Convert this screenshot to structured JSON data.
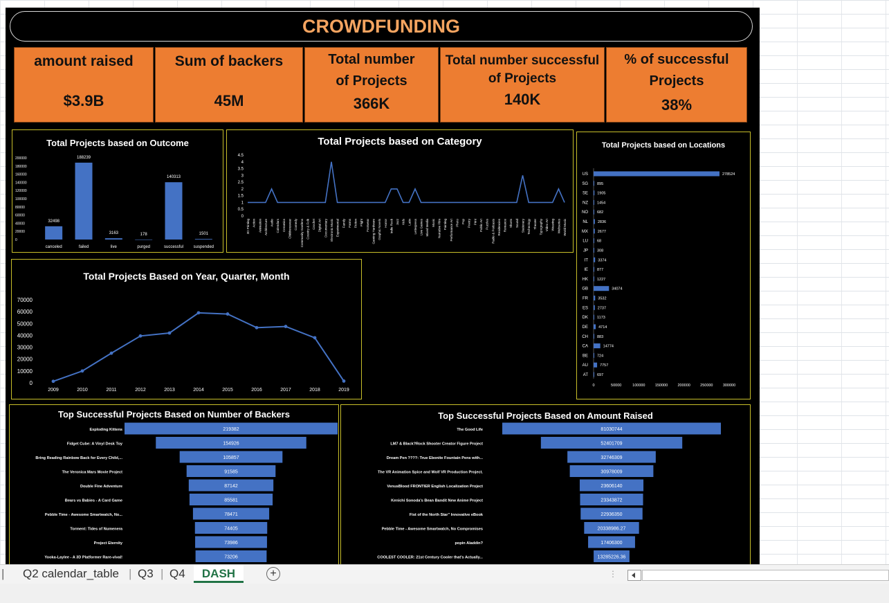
{
  "title": "CROWDFUNDING",
  "kpis": [
    {
      "label": "amount raised",
      "value": "$3.9B"
    },
    {
      "label": "Sum of backers",
      "value": "45M"
    },
    {
      "label": "Total number of Projects",
      "value": "366K"
    },
    {
      "label": "Total number successful of Projects",
      "value": "140K"
    },
    {
      "label": "% of successful Projects",
      "value": "38%"
    }
  ],
  "colors": {
    "bar": "#4472c4",
    "kpi": "#ed7d31",
    "title": "#f4a460",
    "panel_border": "#c9c02a",
    "tab_active": "#217346"
  },
  "sheet_tabs": [
    {
      "label": "Q2 calendar_table",
      "active": false
    },
    {
      "label": "Q3",
      "active": false
    },
    {
      "label": "Q4",
      "active": false
    },
    {
      "label": "DASH",
      "active": true
    }
  ],
  "add_sheet_icon": "plus-circle-icon",
  "chart_data": [
    {
      "type": "bar",
      "title": "Total Projects based on Outcome",
      "categories": [
        "canceled",
        "failed",
        "live",
        "purged",
        "successful",
        "suspended"
      ],
      "values": [
        32498,
        188239,
        3163,
        178,
        140313,
        1501
      ],
      "ylim": [
        0,
        200000
      ],
      "yticks": [
        "0",
        "20000",
        "40000",
        "60000",
        "80000",
        "100000",
        "120000",
        "140000",
        "160000",
        "180000",
        "200000"
      ]
    },
    {
      "type": "line",
      "title": "Total Projects based on  Category",
      "yticks": [
        "0",
        "0.5",
        "1",
        "1.5",
        "2",
        "2.5",
        "3",
        "3.5",
        "4",
        "4.5"
      ],
      "ylim": [
        0,
        4.5
      ],
      "categories": [
        "3D Printing",
        "Action",
        "Animation",
        "Architecture",
        "Audio",
        "Calendars",
        "Ceramics",
        "Childrenswear",
        "Comedy",
        "Community Gardens",
        "Country & Folk",
        "Crochet",
        "Digital Art",
        "Documentary",
        "Electronic Music",
        "Experimental",
        "Family",
        "Farms",
        "Fiction",
        "Flight",
        "Footwear",
        "Gaming Hardware",
        "Graphic Novels",
        "Horror",
        "Indie Rock",
        "Jazz",
        "Kids",
        "Latin",
        "Letterpress",
        "Live Games",
        "Mixed Media",
        "Music",
        "Narrative Film",
        "Painting",
        "Performance Art",
        "Photo",
        "Pop",
        "Poetry",
        "Print",
        "Public Art",
        "Puzzles",
        "Radio & Podcasts",
        "Residencies",
        "Romance",
        "Shorts",
        "Sound",
        "Stationery",
        "Technology",
        "Theater",
        "Typography",
        "Video Art",
        "Weaving",
        "Webseries",
        "World Music"
      ],
      "values": [
        1,
        1,
        1,
        1,
        2,
        1,
        1,
        1,
        1,
        1,
        1,
        1,
        1,
        1,
        4,
        1,
        1,
        1,
        1,
        1,
        1,
        1,
        1,
        1,
        2,
        2,
        1,
        1,
        2,
        1,
        1,
        1,
        1,
        1,
        1,
        1,
        1,
        1,
        1,
        1,
        1,
        1,
        1,
        1,
        1,
        1,
        3,
        1,
        1,
        1,
        1,
        1,
        2,
        1
      ]
    },
    {
      "type": "bar",
      "orientation": "horizontal",
      "title": "Total Projects based on Locations",
      "categories": [
        "US",
        "SG",
        "SE",
        "NZ",
        "NO",
        "NL",
        "MX",
        "LU",
        "JP",
        "IT",
        "IE",
        "HK",
        "GB",
        "FR",
        "ES",
        "DK",
        "DE",
        "CH",
        "CA",
        "BE",
        "AU",
        "AT"
      ],
      "values": [
        278524,
        895,
        1905,
        1454,
        682,
        2836,
        2677,
        68,
        308,
        3374,
        877,
        1227,
        34074,
        3532,
        2737,
        1173,
        4714,
        883,
        14774,
        724,
        7757,
        697
      ],
      "xlim": [
        0,
        300000
      ],
      "xticks": [
        "0",
        "50000",
        "100000",
        "150000",
        "200000",
        "250000",
        "300000"
      ]
    },
    {
      "type": "line",
      "title": "Total Projects Based on Year, Quarter, Month",
      "x": [
        "2009",
        "2010",
        "2011",
        "2012",
        "2013",
        "2014",
        "2015",
        "2016",
        "2017",
        "2018",
        "2019"
      ],
      "values": [
        1300,
        10000,
        25000,
        39500,
        42000,
        59000,
        58000,
        46500,
        47500,
        38000,
        1500
      ],
      "ylim": [
        0,
        70000
      ],
      "yticks": [
        "0",
        "10000",
        "20000",
        "30000",
        "40000",
        "50000",
        "60000",
        "70000"
      ]
    },
    {
      "type": "bar",
      "orientation": "funnel",
      "title": "Top Successful Projects Based on Number of Backers",
      "categories": [
        "Exploding Kittens",
        "Fidget Cube: A Vinyl Desk Toy",
        "Bring Reading Rainbow Back for Every Child,...",
        "The Veronica Mars Movie Project",
        "Double Fine Adventure",
        "Bears vs Babies - A Card Game",
        "Pebble Time - Awesome Smartwatch, No...",
        "Torment: Tides of Numenera",
        "Project Eternity",
        "Yooka-Laylee - A 3D Platformer Rare-vival!"
      ],
      "values": [
        219382,
        154926,
        105857,
        91585,
        87142,
        85581,
        78471,
        74405,
        73986,
        73206
      ],
      "labels": [
        "219382",
        "154926",
        "105857",
        "91585",
        "87142",
        "85581",
        "78471",
        "74405",
        "73986",
        "73206"
      ]
    },
    {
      "type": "bar",
      "orientation": "funnel",
      "title": "Top Successful Projects Based on Amount Raised",
      "categories": [
        "The Good Life",
        "LM7 & Black?Rock Shooter Creator Figure Project",
        "Dream Pen ????: True Ebonite Fountain Pens with...",
        "The VR Animation Spice and Wolf VR Production Project.",
        "VenusBlood FRONTIER English Localization Project",
        "Kenichi Sonoda's Bean Bandit New Anime Project",
        "Fist of the North Star\" Innovative eBook",
        "Pebble Time - Awesome Smartwatch, No Compromises",
        "popin Aladdin?",
        "COOLEST COOLER: 21st Century Cooler that's Actually..."
      ],
      "values": [
        81030744,
        52401709,
        32746309,
        30978009,
        23606140,
        23343872,
        22936350,
        20338986.27,
        17406300,
        13285226.36
      ],
      "labels": [
        "81030744",
        "52401709",
        "32746309",
        "30978009",
        "23606140",
        "23343872",
        "22936350",
        "20338986.27",
        "17406300",
        "13285226.36"
      ]
    }
  ]
}
